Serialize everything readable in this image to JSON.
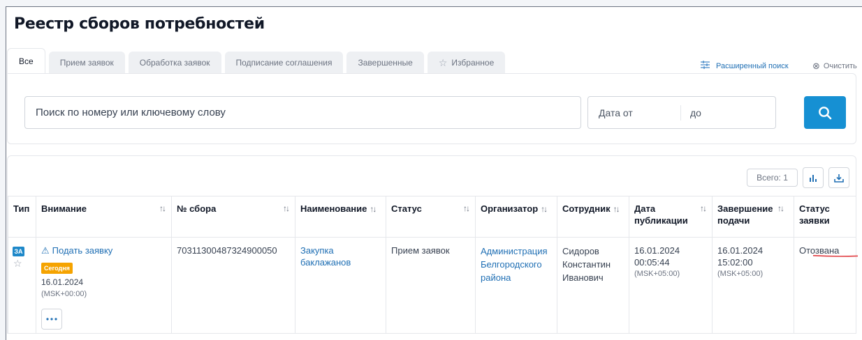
{
  "page": {
    "title": "Реестр сборов потребностей"
  },
  "tabs": [
    {
      "label": "Все",
      "active": true
    },
    {
      "label": "Прием заявок"
    },
    {
      "label": "Обработка заявок"
    },
    {
      "label": "Подписание соглашения"
    },
    {
      "label": "Завершенные"
    },
    {
      "label": "Избранное",
      "icon": "star-icon"
    }
  ],
  "actions": {
    "advanced_search": "Расширенный поиск",
    "clear": "Очистить"
  },
  "search": {
    "placeholder": "Поиск по номеру или ключевому слову",
    "date_from": "Дата от",
    "date_to": "до"
  },
  "table": {
    "total": "Всего: 1",
    "columns": [
      {
        "label": "Тип"
      },
      {
        "label": "Внимание"
      },
      {
        "label": "№ сбора"
      },
      {
        "label": "Наименование"
      },
      {
        "label": "Статус"
      },
      {
        "label": "Организатор"
      },
      {
        "label": "Сотрудник"
      },
      {
        "label": "Дата публикации"
      },
      {
        "label": "Завершение подачи"
      },
      {
        "label": "Статус заявки"
      }
    ],
    "rows": [
      {
        "type_badge": "ЗА",
        "attention_link": "Подать заявку",
        "today_badge": "Сегодня",
        "attention_date": "16.01.2024",
        "attention_tz": "(MSK+00:00)",
        "number": "70311300487324900050",
        "name": "Закупка баклажанов",
        "status": "Прием заявок",
        "organizer": "Администрация Белгородского района",
        "employee": "Сидоров Константин Иванович",
        "published_date": "16.01.2024",
        "published_time": "00:05:44",
        "published_tz": "(MSK+05:00)",
        "deadline_date": "16.01.2024",
        "deadline_time": "15:02:00",
        "deadline_tz": "(MSK+05:00)",
        "application_status": "Отозвана"
      }
    ]
  },
  "colors": {
    "accent": "#1690d3",
    "link": "#1f6fb4",
    "badge_today": "#f5a300",
    "underline": "#e0393e"
  }
}
